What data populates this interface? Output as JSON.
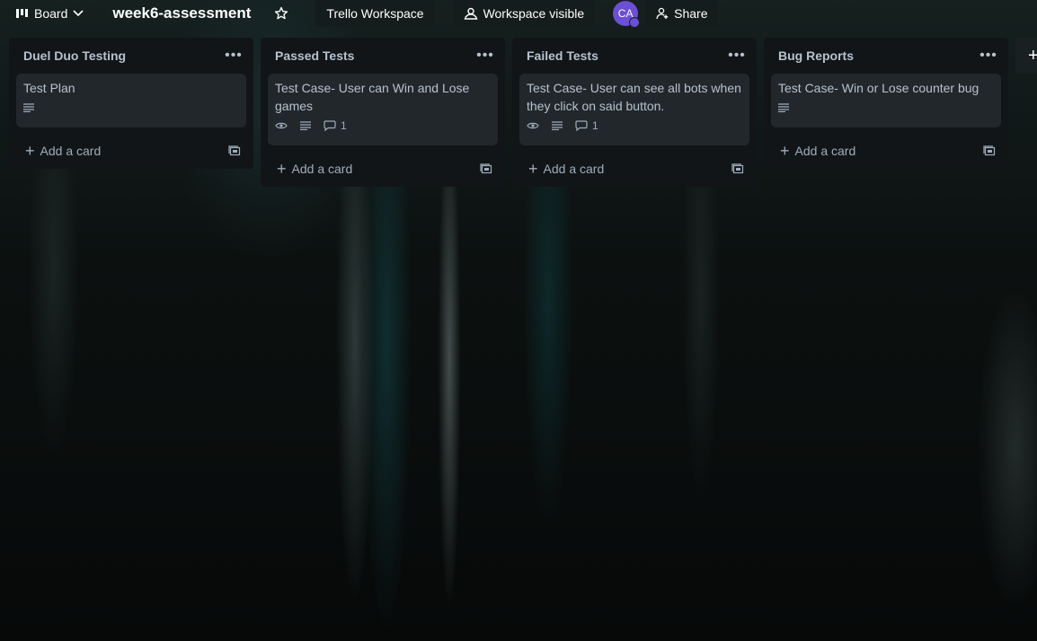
{
  "header": {
    "board_switch_label": "Board",
    "board_title": "week6-assessment",
    "workspace_label": "Trello Workspace",
    "visibility_label": "Workspace visible",
    "avatar_initials": "CA",
    "share_label": "Share"
  },
  "lists": [
    {
      "title": "Duel Duo Testing",
      "cards": [
        {
          "title": "Test Plan",
          "has_description": true,
          "watching": false,
          "comments": ""
        }
      ],
      "add_card_label": "Add a card"
    },
    {
      "title": "Passed Tests",
      "cards": [
        {
          "title": "Test Case- User can Win and Lose games",
          "has_description": true,
          "watching": true,
          "comments": "1"
        }
      ],
      "add_card_label": "Add a card"
    },
    {
      "title": "Failed Tests",
      "cards": [
        {
          "title": "Test Case- User can see all bots when they click on said button.",
          "has_description": true,
          "watching": true,
          "comments": "1"
        }
      ],
      "add_card_label": "Add a card"
    },
    {
      "title": "Bug Reports",
      "cards": [
        {
          "title": "Test Case- Win or Lose counter bug",
          "has_description": true,
          "watching": false,
          "comments": ""
        }
      ],
      "add_card_label": "Add a card"
    }
  ],
  "icons": {
    "board": "board-icon",
    "chevron": "chevron-down-icon",
    "star": "star-icon",
    "visibility": "workspace-visible-icon",
    "share": "share-icon",
    "menu": "more-icon",
    "description": "description-icon",
    "watch": "eye-icon",
    "comment": "comment-icon",
    "template": "card-template-icon",
    "add": "plus-icon"
  },
  "colors": {
    "list_bg": "#121517",
    "card_bg": "#22272b",
    "avatar": "#6b4fd6",
    "text": "#b6c2cf"
  }
}
